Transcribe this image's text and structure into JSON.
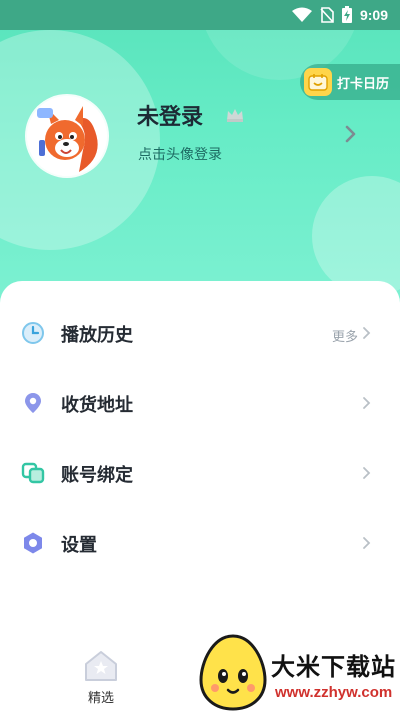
{
  "status_bar": {
    "time": "9:09"
  },
  "checkin": {
    "label": "打卡日历"
  },
  "profile": {
    "username": "未登录",
    "login_hint": "点击头像登录"
  },
  "menu": [
    {
      "label": "播放历史",
      "more": "更多",
      "icon": "clock-icon"
    },
    {
      "label": "收货地址",
      "icon": "location-pin-icon"
    },
    {
      "label": "账号绑定",
      "icon": "link-icon"
    },
    {
      "label": "设置",
      "icon": "settings-hexagon-icon"
    }
  ],
  "bottom_nav": {
    "tabs": [
      {
        "label": "精选",
        "icon": "home-icon"
      }
    ]
  },
  "watermark": {
    "title": "大米下载站",
    "url": "www.zzhyw.com"
  },
  "colors": {
    "header_green": "#5fe8c0",
    "accent_teal": "#2bb59a",
    "icon_violet": "#7b86e8"
  }
}
